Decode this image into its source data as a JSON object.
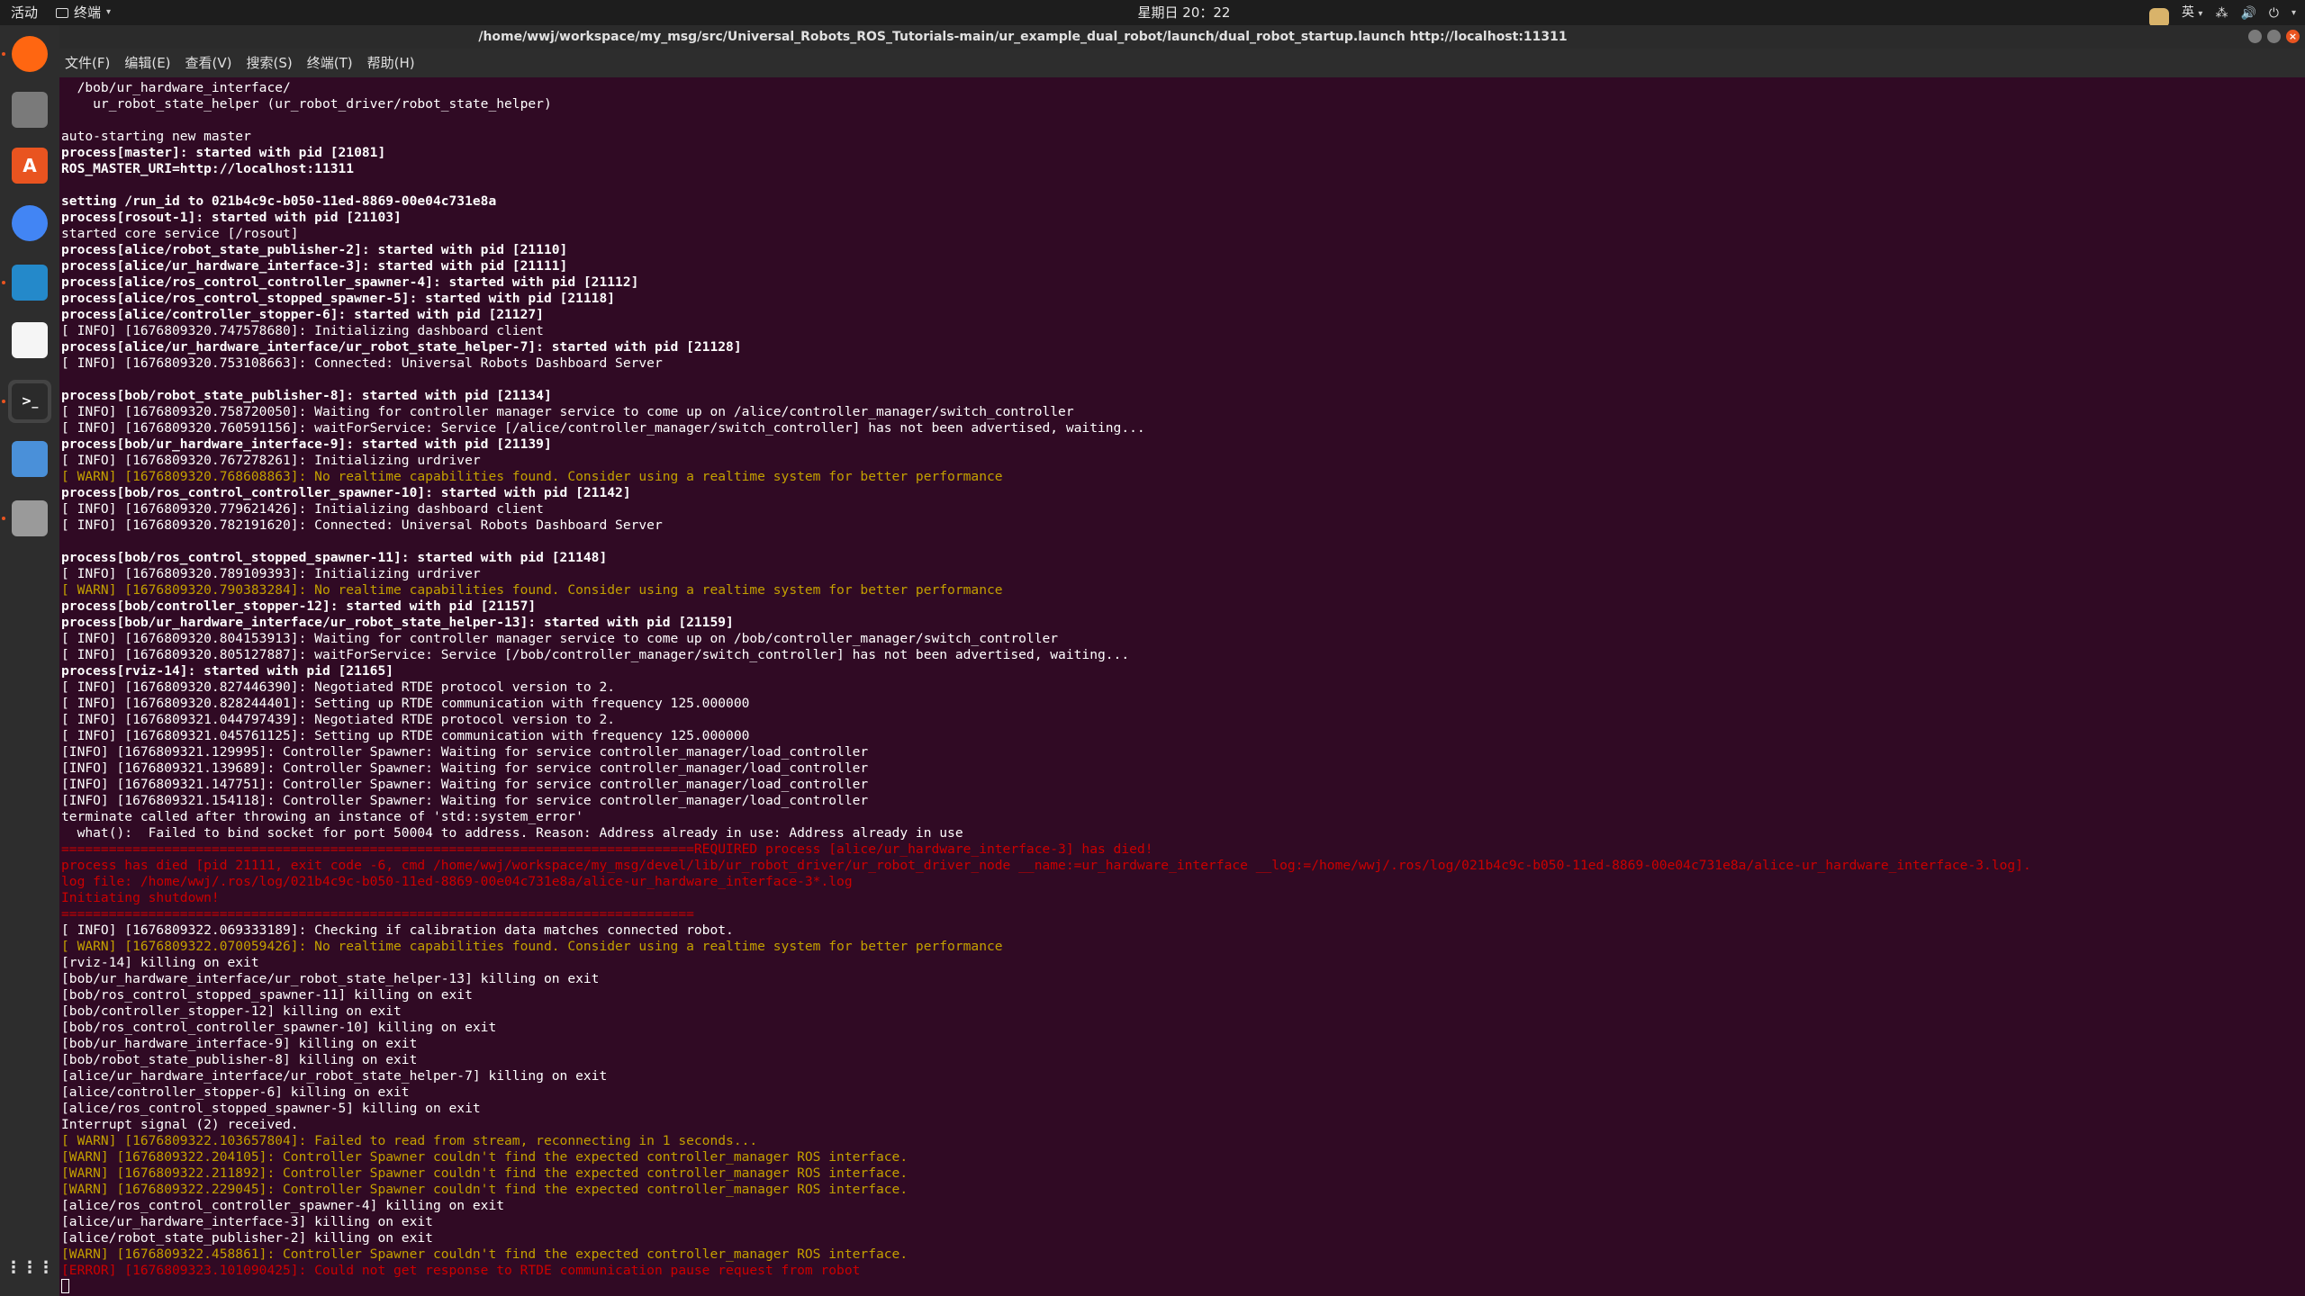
{
  "topbar": {
    "activities": "活动",
    "app_name": "终端",
    "clock": "星期日 20：22",
    "input_method": "英"
  },
  "dock": {
    "apps": [
      {
        "name": "firefox",
        "label": "",
        "color": "#ff6611"
      },
      {
        "name": "files",
        "label": "",
        "color": "#7a7a7a"
      },
      {
        "name": "software-center",
        "label": "A",
        "color": "#e95420"
      },
      {
        "name": "chrome",
        "label": "",
        "color": "#4285f4"
      },
      {
        "name": "vscode",
        "label": "",
        "color": "#2489ca"
      },
      {
        "name": "text-editor",
        "label": "",
        "color": "#f5f5f5"
      },
      {
        "name": "terminal",
        "label": ">_",
        "color": "#2b2b2b"
      },
      {
        "name": "app-8",
        "label": "",
        "color": "#4a90d9"
      },
      {
        "name": "settings",
        "label": "",
        "color": "#9a9a9a"
      }
    ],
    "show_apps_label": "⋮⋮⋮"
  },
  "window": {
    "title": "/home/wwj/workspace/my_msg/src/Universal_Robots_ROS_Tutorials-main/ur_example_dual_robot/launch/dual_robot_startup.launch http://localhost:11311",
    "menu": [
      "文件(F)",
      "编辑(E)",
      "查看(V)",
      "搜索(S)",
      "终端(T)",
      "帮助(H)"
    ]
  },
  "terminal": {
    "lines": [
      {
        "t": "  /bob/ur_hardware_interface/",
        "s": "n"
      },
      {
        "t": "    ur_robot_state_helper (ur_robot_driver/robot_state_helper)",
        "s": "n"
      },
      {
        "t": "",
        "s": "n"
      },
      {
        "t": "auto-starting new master",
        "s": "n"
      },
      {
        "t": "process[master]: started with pid [21081]",
        "s": "b"
      },
      {
        "t": "ROS_MASTER_URI=http://localhost:11311",
        "s": "b"
      },
      {
        "t": "",
        "s": "n"
      },
      {
        "t": "setting /run_id to 021b4c9c-b050-11ed-8869-00e04c731e8a",
        "s": "b"
      },
      {
        "t": "process[rosout-1]: started with pid [21103]",
        "s": "b"
      },
      {
        "t": "started core service [/rosout]",
        "s": "n"
      },
      {
        "t": "process[alice/robot_state_publisher-2]: started with pid [21110]",
        "s": "b"
      },
      {
        "t": "process[alice/ur_hardware_interface-3]: started with pid [21111]",
        "s": "b"
      },
      {
        "t": "process[alice/ros_control_controller_spawner-4]: started with pid [21112]",
        "s": "b"
      },
      {
        "t": "process[alice/ros_control_stopped_spawner-5]: started with pid [21118]",
        "s": "b"
      },
      {
        "t": "process[alice/controller_stopper-6]: started with pid [21127]",
        "s": "b"
      },
      {
        "t": "[ INFO] [1676809320.747578680]: Initializing dashboard client",
        "s": "n"
      },
      {
        "t": "process[alice/ur_hardware_interface/ur_robot_state_helper-7]: started with pid [21128]",
        "s": "b"
      },
      {
        "t": "[ INFO] [1676809320.753108663]: Connected: Universal Robots Dashboard Server",
        "s": "n"
      },
      {
        "t": "",
        "s": "n"
      },
      {
        "t": "process[bob/robot_state_publisher-8]: started with pid [21134]",
        "s": "b"
      },
      {
        "t": "[ INFO] [1676809320.758720050]: Waiting for controller manager service to come up on /alice/controller_manager/switch_controller",
        "s": "n"
      },
      {
        "t": "[ INFO] [1676809320.760591156]: waitForService: Service [/alice/controller_manager/switch_controller] has not been advertised, waiting...",
        "s": "n"
      },
      {
        "t": "process[bob/ur_hardware_interface-9]: started with pid [21139]",
        "s": "b"
      },
      {
        "t": "[ INFO] [1676809320.767278261]: Initializing urdriver",
        "s": "n"
      },
      {
        "t": "[ WARN] [1676809320.768608863]: No realtime capabilities found. Consider using a realtime system for better performance",
        "s": "w"
      },
      {
        "t": "process[bob/ros_control_controller_spawner-10]: started with pid [21142]",
        "s": "b"
      },
      {
        "t": "[ INFO] [1676809320.779621426]: Initializing dashboard client",
        "s": "n"
      },
      {
        "t": "[ INFO] [1676809320.782191620]: Connected: Universal Robots Dashboard Server",
        "s": "n"
      },
      {
        "t": "",
        "s": "n"
      },
      {
        "t": "process[bob/ros_control_stopped_spawner-11]: started with pid [21148]",
        "s": "b"
      },
      {
        "t": "[ INFO] [1676809320.789109393]: Initializing urdriver",
        "s": "n"
      },
      {
        "t": "[ WARN] [1676809320.790383284]: No realtime capabilities found. Consider using a realtime system for better performance",
        "s": "w"
      },
      {
        "t": "process[bob/controller_stopper-12]: started with pid [21157]",
        "s": "b"
      },
      {
        "t": "process[bob/ur_hardware_interface/ur_robot_state_helper-13]: started with pid [21159]",
        "s": "b"
      },
      {
        "t": "[ INFO] [1676809320.804153913]: Waiting for controller manager service to come up on /bob/controller_manager/switch_controller",
        "s": "n"
      },
      {
        "t": "[ INFO] [1676809320.805127887]: waitForService: Service [/bob/controller_manager/switch_controller] has not been advertised, waiting...",
        "s": "n"
      },
      {
        "t": "process[rviz-14]: started with pid [21165]",
        "s": "b"
      },
      {
        "t": "[ INFO] [1676809320.827446390]: Negotiated RTDE protocol version to 2.",
        "s": "n"
      },
      {
        "t": "[ INFO] [1676809320.828244401]: Setting up RTDE communication with frequency 125.000000",
        "s": "n"
      },
      {
        "t": "[ INFO] [1676809321.044797439]: Negotiated RTDE protocol version to 2.",
        "s": "n"
      },
      {
        "t": "[ INFO] [1676809321.045761125]: Setting up RTDE communication with frequency 125.000000",
        "s": "n"
      },
      {
        "t": "[INFO] [1676809321.129995]: Controller Spawner: Waiting for service controller_manager/load_controller",
        "s": "n"
      },
      {
        "t": "[INFO] [1676809321.139689]: Controller Spawner: Waiting for service controller_manager/load_controller",
        "s": "n"
      },
      {
        "t": "[INFO] [1676809321.147751]: Controller Spawner: Waiting for service controller_manager/load_controller",
        "s": "n"
      },
      {
        "t": "[INFO] [1676809321.154118]: Controller Spawner: Waiting for service controller_manager/load_controller",
        "s": "n"
      },
      {
        "t": "terminate called after throwing an instance of 'std::system_error'",
        "s": "n"
      },
      {
        "t": "  what():  Failed to bind socket for port 50004 to address. Reason: Address already in use: Address already in use",
        "s": "n"
      },
      {
        "t": "================================================================================REQUIRED process [alice/ur_hardware_interface-3] has died!",
        "s": "e"
      },
      {
        "t": "process has died [pid 21111, exit code -6, cmd /home/wwj/workspace/my_msg/devel/lib/ur_robot_driver/ur_robot_driver_node __name:=ur_hardware_interface __log:=/home/wwj/.ros/log/021b4c9c-b050-11ed-8869-00e04c731e8a/alice-ur_hardware_interface-3.log].",
        "s": "e"
      },
      {
        "t": "log file: /home/wwj/.ros/log/021b4c9c-b050-11ed-8869-00e04c731e8a/alice-ur_hardware_interface-3*.log",
        "s": "e"
      },
      {
        "t": "Initiating shutdown!",
        "s": "e"
      },
      {
        "t": "================================================================================",
        "s": "e"
      },
      {
        "t": "[ INFO] [1676809322.069333189]: Checking if calibration data matches connected robot.",
        "s": "n"
      },
      {
        "t": "[ WARN] [1676809322.070059426]: No realtime capabilities found. Consider using a realtime system for better performance",
        "s": "w"
      },
      {
        "t": "[rviz-14] killing on exit",
        "s": "n"
      },
      {
        "t": "[bob/ur_hardware_interface/ur_robot_state_helper-13] killing on exit",
        "s": "n"
      },
      {
        "t": "[bob/ros_control_stopped_spawner-11] killing on exit",
        "s": "n"
      },
      {
        "t": "[bob/controller_stopper-12] killing on exit",
        "s": "n"
      },
      {
        "t": "[bob/ros_control_controller_spawner-10] killing on exit",
        "s": "n"
      },
      {
        "t": "[bob/ur_hardware_interface-9] killing on exit",
        "s": "n"
      },
      {
        "t": "[bob/robot_state_publisher-8] killing on exit",
        "s": "n"
      },
      {
        "t": "[alice/ur_hardware_interface/ur_robot_state_helper-7] killing on exit",
        "s": "n"
      },
      {
        "t": "[alice/controller_stopper-6] killing on exit",
        "s": "n"
      },
      {
        "t": "[alice/ros_control_stopped_spawner-5] killing on exit",
        "s": "n"
      },
      {
        "t": "Interrupt signal (2) received.",
        "s": "n"
      },
      {
        "t": "[ WARN] [1676809322.103657804]: Failed to read from stream, reconnecting in 1 seconds...",
        "s": "w"
      },
      {
        "t": "[WARN] [1676809322.204105]: Controller Spawner couldn't find the expected controller_manager ROS interface.",
        "s": "w"
      },
      {
        "t": "[WARN] [1676809322.211892]: Controller Spawner couldn't find the expected controller_manager ROS interface.",
        "s": "w"
      },
      {
        "t": "[WARN] [1676809322.229045]: Controller Spawner couldn't find the expected controller_manager ROS interface.",
        "s": "w"
      },
      {
        "t": "[alice/ros_control_controller_spawner-4] killing on exit",
        "s": "n"
      },
      {
        "t": "[alice/ur_hardware_interface-3] killing on exit",
        "s": "n"
      },
      {
        "t": "[alice/robot_state_publisher-2] killing on exit",
        "s": "n"
      },
      {
        "t": "[WARN] [1676809322.458861]: Controller Spawner couldn't find the expected controller_manager ROS interface.",
        "s": "w"
      },
      {
        "t": "[ERROR] [1676809323.101090425]: Could not get response to RTDE communication pause request from robot",
        "s": "e"
      }
    ]
  },
  "colors": {
    "terminal_bg": "#300a24",
    "text": "#ffffff",
    "warn": "#c4a000",
    "error": "#cc0000",
    "accent": "#e95420"
  }
}
